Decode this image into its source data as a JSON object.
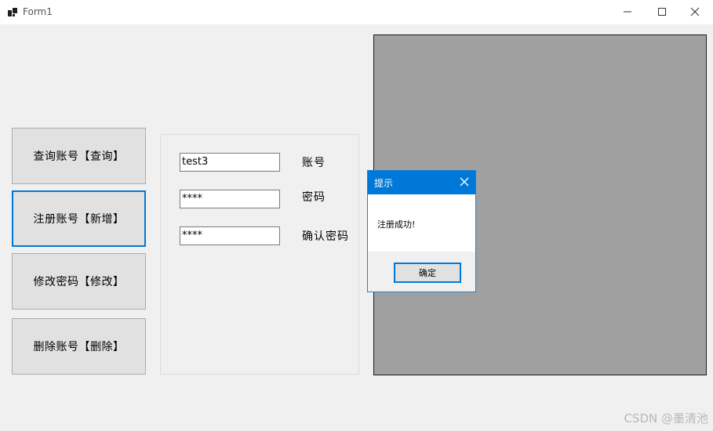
{
  "window": {
    "title": "Form1",
    "minimize": "—",
    "maximize": "☐",
    "close": "✕"
  },
  "buttons": {
    "query": "查询账号【查询】",
    "register": "注册账号【新增】",
    "modify": "修改密码【修改】",
    "delete": "删除账号【删除】"
  },
  "form": {
    "account_value": "test3",
    "account_label": "账号",
    "password_value": "****",
    "password_label": "密码",
    "confirm_value": "****",
    "confirm_label": "确认密码"
  },
  "dialog": {
    "title": "提示",
    "message": "注册成功!",
    "ok_label": "确定"
  },
  "watermark": "CSDN @墨清池",
  "colors": {
    "accent": "#0078d7",
    "picture_bg": "#a0a0a0",
    "window_bg": "#f0f0f0"
  }
}
